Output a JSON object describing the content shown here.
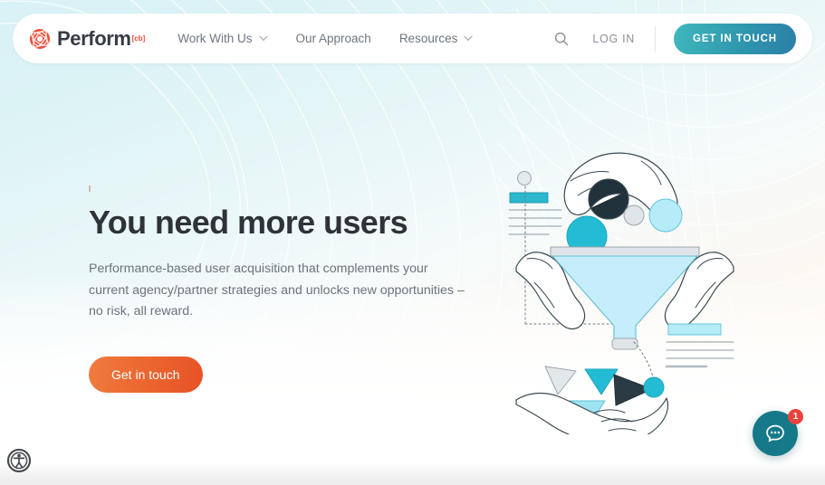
{
  "header": {
    "logo": {
      "text": "Perform",
      "superscript": "[cb]",
      "icon": "globe-icon"
    },
    "nav": [
      {
        "label": "Work With Us",
        "has_dropdown": true
      },
      {
        "label": "Our Approach",
        "has_dropdown": false
      },
      {
        "label": "Resources",
        "has_dropdown": true
      }
    ],
    "search_icon": "search-icon",
    "login_label": "LOG IN",
    "cta_label": "GET IN TOUCH"
  },
  "hero": {
    "headline": "You need more users",
    "subcopy": "Performance-based user acquisition that complements your current agency/partner strategies and unlocks new opportunities – no risk, all reward.",
    "cta_label": "Get in touch"
  },
  "illustration": {
    "name": "hands-funnel-illustration",
    "description": "Hands dropping circles into a funnel with triangles falling into a cupped hand below"
  },
  "widgets": {
    "accessibility_icon": "accessibility-icon",
    "chat_icon": "chat-bubble-icon",
    "chat_badge_count": "1"
  },
  "colors": {
    "brand_orange": "#e8503a",
    "cta_teal_start": "#3fb8bd",
    "cta_teal_end": "#2b7fa6",
    "cta_orange_start": "#f07b3f",
    "cta_orange_end": "#e75226",
    "chat_teal": "#16798a",
    "badge_red": "#e8443c",
    "headline": "#2f3239",
    "body_text": "#6b737c"
  }
}
